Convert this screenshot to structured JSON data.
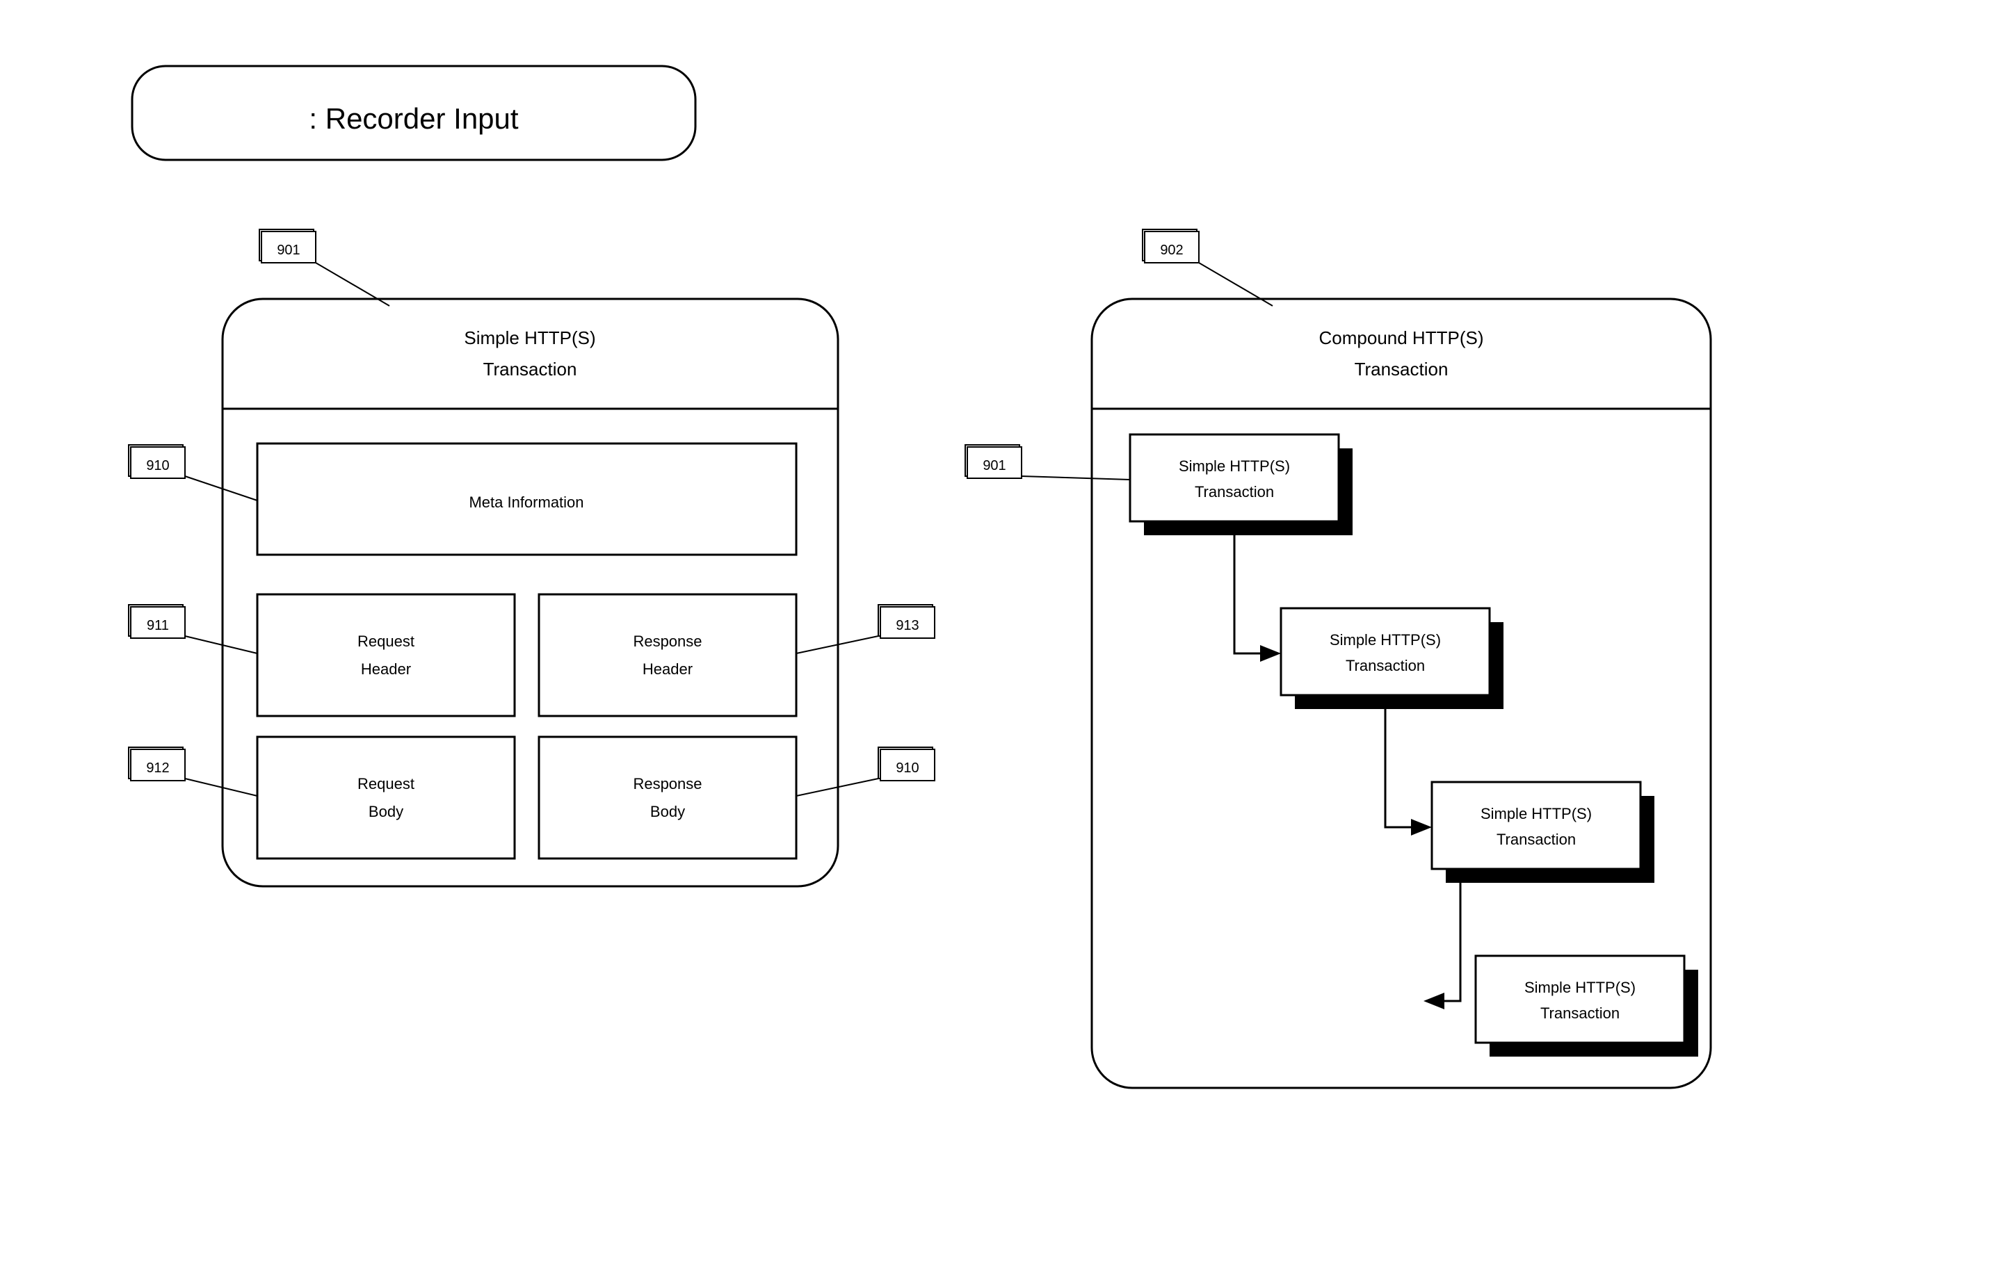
{
  "header": {
    "title": ": Recorder Input"
  },
  "refs": {
    "r901a": "901",
    "r902": "902",
    "r910a": "910",
    "r911": "911",
    "r912": "912",
    "r913": "913",
    "r910b": "910",
    "r901b": "901"
  },
  "simple_panel": {
    "title_l1": "Simple HTTP(S)",
    "title_l2": "Transaction",
    "meta": "Meta Information",
    "req_h_l1": "Request",
    "req_h_l2": "Header",
    "res_h_l1": "Response",
    "res_h_l2": "Header",
    "req_b_l1": "Request",
    "req_b_l2": "Body",
    "res_b_l1": "Response",
    "res_b_l2": "Body"
  },
  "compound_panel": {
    "title_l1": "Compound HTTP(S)",
    "title_l2": "Transaction",
    "node_l1": "Simple HTTP(S)",
    "node_l2": "Transaction"
  }
}
